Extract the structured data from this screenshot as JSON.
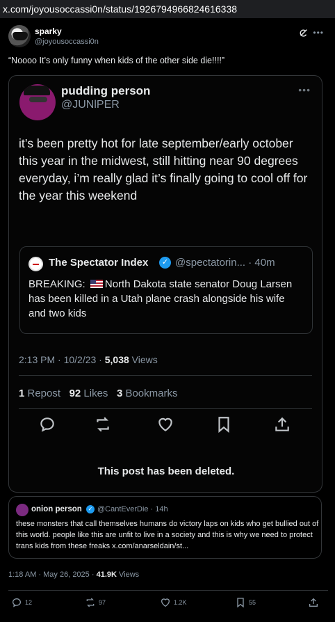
{
  "browser": {
    "url": "x.com/joyousoccassi0n/status/1926794966824616338"
  },
  "post": {
    "name": "sparky",
    "handle": "@joyousoccassi0n",
    "text": "“Noooo It’s only funny when kids of the other side die!!!!”",
    "time": "1:18 AM · May 26, 2025 · ",
    "views_count": "41.9K",
    "views_label": " Views",
    "replies": "12",
    "reposts": "97",
    "likes": "1.2K",
    "bookmarks": "55"
  },
  "quoted_post": {
    "name": "pudding person",
    "handle": "@JUNlPER",
    "body": "it’s been pretty hot for late september/early october this year in the midwest, still hitting near 90 degrees everyday, i’m really glad it’s finally going to cool off for the year this weekend",
    "inner_quote": {
      "name": "The Spectator Index",
      "handle": "@spectatorin... · 40m",
      "body_before_flag": "BREAKING: ",
      "body_after_flag": "North Dakota state senator Doug Larsen has been killed in a Utah plane crash alongside his wife and two kids"
    },
    "time": "2:13 PM · 10/2/23 · ",
    "views_count": "5,038",
    "views_label": " Views",
    "repost_count": "1",
    "repost_label": " Repost",
    "likes_count": "92",
    "likes_label": " Likes",
    "bookmarks_count": "3",
    "bookmarks_label": " Bookmarks",
    "deleted_notice": "This post has been deleted."
  },
  "second_quote": {
    "name": "onion person",
    "handle": "@CantEverDie · 14h",
    "body": "these monsters that call themselves humans do victory laps on kids who get bullied out of this world.  people like this are unfit to live in a society and this is why we need to protect trans kids from these freaks x.com/anarseldain/st..."
  },
  "colors": {
    "accent": "#1d9bf0",
    "background": "#000000",
    "muted": "#8b98a5"
  },
  "icons": [
    "grok-icon",
    "more-icon",
    "verified-icon",
    "reply-icon",
    "repost-icon",
    "like-icon",
    "bookmark-icon",
    "share-icon",
    "flag-us-icon"
  ]
}
